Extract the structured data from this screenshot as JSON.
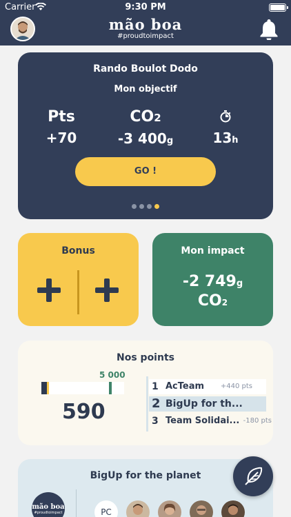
{
  "status_bar": {
    "carrier": "Carrier",
    "time": "9:30 PM"
  },
  "header": {
    "brand": "mão boa",
    "tagline": "#proudtoimpact"
  },
  "objective_card": {
    "title": "Rando Boulot Dodo",
    "subtitle": "Mon objectif",
    "points_label": "Pts",
    "points_value": "+70",
    "co2_label_main": "CO",
    "co2_label_sub": "2",
    "co2_value": "-3 400",
    "co2_unit": "g",
    "time_value": "13",
    "time_unit": "h",
    "go_label": "GO !",
    "pager": {
      "count": 4,
      "active_index": 3
    }
  },
  "bonus_card": {
    "title": "Bonus"
  },
  "impact_card": {
    "title": "Mon impact",
    "value": "-2 749",
    "unit": "g",
    "co2_main": "CO",
    "co2_sub": "2"
  },
  "points_card": {
    "title": "Nos points",
    "target": "5 000",
    "score": "590",
    "ranking": [
      {
        "rank": "1",
        "name": "AcTeam",
        "points": "+440 pts"
      },
      {
        "rank": "2",
        "name": "BigUp for th...",
        "points": ""
      },
      {
        "rank": "3",
        "name": "Team Solidai...",
        "points": "-180 pts"
      }
    ]
  },
  "team_card": {
    "title": "BigUp for the planet",
    "logo_brand": "mão boa",
    "logo_tag": "#proudtoimpact",
    "member_initials": "PC"
  },
  "colors": {
    "navy": "#323e58",
    "yellow": "#f8c94d",
    "green": "#3e8368",
    "cream": "#fbf8ef",
    "light_blue": "#dde9ef"
  }
}
